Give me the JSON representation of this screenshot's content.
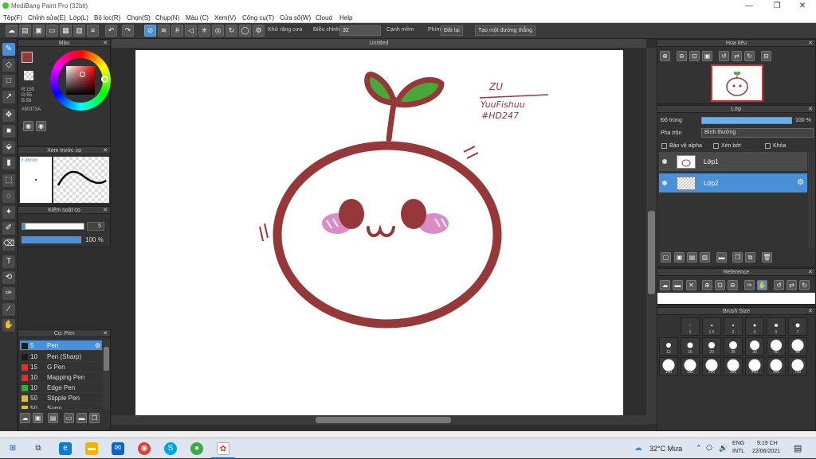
{
  "window": {
    "title": "MediBang Paint Pro (32bit)",
    "min": "—",
    "max": "❐",
    "close": "✕"
  },
  "menu": [
    "Tệp(F)",
    "Chỉnh sửa(E)",
    "Lớp(L)",
    "Bộ lọc(R)",
    "Chọn(S)",
    "Chụp(N)",
    "Màu (C)",
    "Xem(V)",
    "Công cụ(T)",
    "Cửa sổ(W)",
    "Cloud",
    "Help"
  ],
  "toolbar": {
    "antialias_label": "Khử răng cưa",
    "adjust_label": "Điều chỉnh",
    "adjust_value": "32",
    "smooth_label": "Cạnh mềm",
    "key_label": "Phím",
    "cancel_label": "Đặt lại",
    "create_guide_label": "Tạo một đường thẳng"
  },
  "color_panel": {
    "title": "Màu",
    "r": "R:150",
    "g": "G:55",
    "b": "B:58",
    "hex": "#90373A",
    "primary_color": "#96373A"
  },
  "brush_preview": {
    "title": "Xem trước cọ",
    "size_label": "0.36mm"
  },
  "brush_control": {
    "title": "Kiểm soát cọ",
    "size_value": "5",
    "opacity_value": "100 %"
  },
  "brush_list": {
    "title": "Cọ: Pen",
    "items": [
      {
        "num": "5",
        "name": "Pen",
        "color": "#1a1a1a"
      },
      {
        "num": "10",
        "name": "Pen (Sharp)",
        "color": "#1a1a1a"
      },
      {
        "num": "15",
        "name": "G Pen",
        "color": "#e03030"
      },
      {
        "num": "10",
        "name": "Mapping Pen",
        "color": "#e03030"
      },
      {
        "num": "10",
        "name": "Edge Pen",
        "color": "#30b030"
      },
      {
        "num": "50",
        "name": "Stipple Pen",
        "color": "#e0c020"
      },
      {
        "num": "50",
        "name": "Sumi",
        "color": "#e0c020"
      }
    ]
  },
  "canvas": {
    "tab_title": "Untitled",
    "text_line1": "ZU",
    "text_line2": "YuuFishuu",
    "text_line3": "#HD247",
    "stroke_color": "#96373A",
    "leaf_color": "#4aa83a",
    "cheek_color": "#d98cc6"
  },
  "navigator": {
    "title": "Hoa tiêu"
  },
  "layer_panel": {
    "title": "Lớp",
    "opacity_label": "Độ trong",
    "opacity_value": "100 %",
    "blend_label": "Pha trộn",
    "blend_value": "Bình thường",
    "protect_alpha": "Bảo vệ alpha",
    "clipping": "Xén bớt",
    "lock": "Khóa",
    "layers": [
      {
        "name": "Lớp1",
        "selected": false
      },
      {
        "name": "Lớp2",
        "selected": true
      }
    ]
  },
  "reference": {
    "title": "Reference"
  },
  "brush_size": {
    "title": "Brush Size",
    "sizes": [
      "1",
      "1.5",
      "2",
      "3",
      "5",
      "7",
      "12",
      "15",
      "20",
      "25",
      "30",
      "40",
      "50",
      "100",
      "150",
      "200",
      "300",
      "400",
      "500",
      "700"
    ]
  },
  "taskbar": {
    "weather": "32°C Mưa",
    "lang1": "ENG",
    "lang2": "INTL",
    "time": "9:19 CH",
    "date": "22/06/2021"
  }
}
